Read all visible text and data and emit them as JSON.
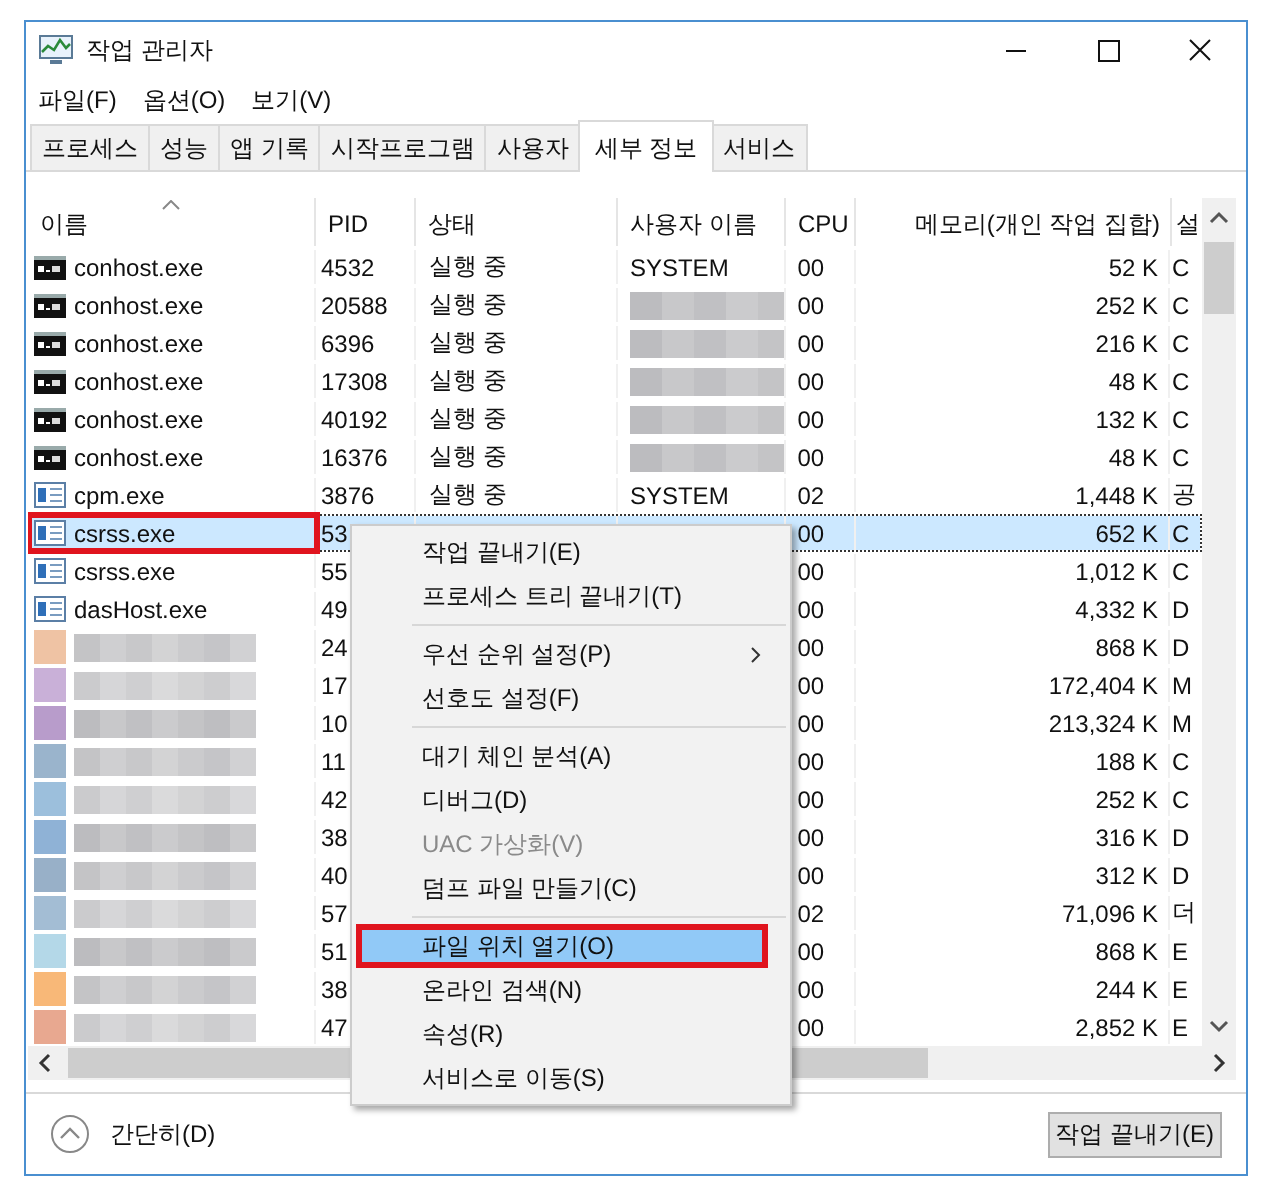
{
  "window": {
    "title": "작업 관리자"
  },
  "menu": [
    "파일(F)",
    "옵션(O)",
    "보기(V)"
  ],
  "tabs": [
    {
      "label": "프로세스",
      "selected": false
    },
    {
      "label": "성능",
      "selected": false
    },
    {
      "label": "앱 기록",
      "selected": false
    },
    {
      "label": "시작프로그램",
      "selected": false
    },
    {
      "label": "사용자",
      "selected": false
    },
    {
      "label": "세부 정보",
      "selected": true
    },
    {
      "label": "서비스",
      "selected": false
    }
  ],
  "table": {
    "columns": [
      "이름",
      "PID",
      "상태",
      "사용자 이름",
      "CPU",
      "메모리(개인 작업 집합)",
      "설"
    ],
    "rows": [
      {
        "kind": "console",
        "name": "conhost.exe",
        "pid": "4532",
        "status": "실행 중",
        "user": "SYSTEM",
        "cpu": "00",
        "memory": "52 K",
        "column_7": "C",
        "selected": false,
        "annotated": false
      },
      {
        "kind": "console",
        "name": "conhost.exe",
        "pid": "20588",
        "status": "실행 중",
        "user_hidden": true,
        "cpu": "00",
        "memory": "252 K",
        "column_7": "C",
        "selected": false,
        "annotated": false
      },
      {
        "kind": "console",
        "name": "conhost.exe",
        "pid": "6396",
        "status": "실행 중",
        "user_hidden": true,
        "cpu": "00",
        "memory": "216 K",
        "column_7": "C",
        "selected": false,
        "annotated": false
      },
      {
        "kind": "console",
        "name": "conhost.exe",
        "pid": "17308",
        "status": "실행 중",
        "user_hidden": true,
        "cpu": "00",
        "memory": "48 K",
        "column_7": "C",
        "selected": false,
        "annotated": false
      },
      {
        "kind": "console",
        "name": "conhost.exe",
        "pid": "40192",
        "status": "실행 중",
        "user_hidden": true,
        "cpu": "00",
        "memory": "132 K",
        "column_7": "C",
        "selected": false,
        "annotated": false
      },
      {
        "kind": "console",
        "name": "conhost.exe",
        "pid": "16376",
        "status": "실행 중",
        "user_hidden": true,
        "cpu": "00",
        "memory": "48 K",
        "column_7": "C",
        "selected": false,
        "annotated": false
      },
      {
        "kind": "app",
        "name": "cpm.exe",
        "pid": "3876",
        "status": "실행 중",
        "user": "SYSTEM",
        "cpu": "02",
        "memory": "1,448 K",
        "column_7": "공",
        "selected": false,
        "annotated": false
      },
      {
        "kind": "app",
        "name": "csrss.exe",
        "pid": "53",
        "cpu": "00",
        "memory": "652 K",
        "column_7": "C",
        "selected": true,
        "annotated": true
      },
      {
        "kind": "app",
        "name": "csrss.exe",
        "pid": "55",
        "cpu": "00",
        "memory": "1,012 K",
        "column_7": "C",
        "selected": false,
        "annotated": false
      },
      {
        "kind": "app",
        "name": "dasHost.exe",
        "pid": "49",
        "cpu": "00",
        "memory": "4,332 K",
        "column_7": "D",
        "selected": false,
        "annotated": false
      },
      {
        "name_hidden": true,
        "color": "#efc3a4",
        "pid": "24",
        "cpu": "00",
        "memory": "868 K",
        "column_7": "D",
        "selected": false,
        "annotated": false
      },
      {
        "name_hidden": true,
        "color": "#c9b0d8",
        "pid": "17",
        "cpu": "00",
        "memory": "172,404 K",
        "column_7": "M",
        "selected": false,
        "annotated": false
      },
      {
        "name_hidden": true,
        "color": "#b89ccb",
        "pid": "10",
        "cpu": "00",
        "memory": "213,324 K",
        "column_7": "M",
        "selected": false,
        "annotated": false
      },
      {
        "name_hidden": true,
        "color": "#9ab4cc",
        "pid": "11",
        "cpu": "00",
        "memory": "188 K",
        "column_7": "C",
        "selected": false,
        "annotated": false
      },
      {
        "name_hidden": true,
        "color": "#9cbfdc",
        "pid": "42",
        "cpu": "00",
        "memory": "252 K",
        "column_7": "C",
        "selected": false,
        "annotated": false
      },
      {
        "name_hidden": true,
        "color": "#8fb2d6",
        "pid": "38",
        "cpu": "00",
        "memory": "316 K",
        "column_7": "D",
        "selected": false,
        "annotated": false
      },
      {
        "name_hidden": true,
        "color": "#98b0c8",
        "pid": "40",
        "cpu": "00",
        "memory": "312 K",
        "column_7": "D",
        "selected": false,
        "annotated": false
      },
      {
        "name_hidden": true,
        "color": "#a3bdd4",
        "pid": "57",
        "cpu": "02",
        "memory": "71,096 K",
        "column_7": "더",
        "selected": false,
        "annotated": false
      },
      {
        "name_hidden": true,
        "color": "#b4d8e8",
        "pid": "51",
        "cpu": "00",
        "memory": "868 K",
        "column_7": "E",
        "selected": false,
        "annotated": false
      },
      {
        "name_hidden": true,
        "color": "#f8b878",
        "pid": "38",
        "cpu": "00",
        "memory": "244 K",
        "column_7": "E",
        "selected": false,
        "annotated": false
      },
      {
        "name_hidden": true,
        "color": "#e8a890",
        "pid": "47",
        "cpu": "00",
        "memory": "2,852 K",
        "column_7": "E",
        "selected": false,
        "annotated": false
      }
    ]
  },
  "context_menu": [
    {
      "kind": "item",
      "label": "작업 끝내기(E)",
      "disabled": false,
      "selected": false,
      "annotated": false
    },
    {
      "kind": "item",
      "label": "프로세스 트리 끝내기(T)",
      "disabled": false,
      "selected": false,
      "annotated": false
    },
    {
      "kind": "separator"
    },
    {
      "kind": "submenu",
      "label": "우선 순위 설정(P)",
      "disabled": false,
      "selected": false,
      "annotated": false
    },
    {
      "kind": "item",
      "label": "선호도 설정(F)",
      "disabled": false,
      "selected": false,
      "annotated": false
    },
    {
      "kind": "separator"
    },
    {
      "kind": "item",
      "label": "대기 체인 분석(A)",
      "disabled": false,
      "selected": false,
      "annotated": false
    },
    {
      "kind": "item",
      "label": "디버그(D)",
      "disabled": false,
      "selected": false,
      "annotated": false
    },
    {
      "kind": "item",
      "label": "UAC 가상화(V)",
      "disabled": true,
      "selected": false,
      "annotated": false
    },
    {
      "kind": "item",
      "label": "덤프 파일 만들기(C)",
      "disabled": false,
      "selected": false,
      "annotated": false
    },
    {
      "kind": "separator"
    },
    {
      "kind": "item",
      "label": "파일 위치 열기(O)",
      "disabled": false,
      "selected": true,
      "annotated": true
    },
    {
      "kind": "item",
      "label": "온라인 검색(N)",
      "disabled": false,
      "selected": false,
      "annotated": false
    },
    {
      "kind": "item",
      "label": "속성(R)",
      "disabled": false,
      "selected": false,
      "annotated": false
    },
    {
      "kind": "item",
      "label": "서비스로 이동(S)",
      "disabled": false,
      "selected": false,
      "annotated": false
    }
  ],
  "footer": {
    "collapse_label": "간단히(D)",
    "end_task_button": "작업 끝내기(E)"
  }
}
